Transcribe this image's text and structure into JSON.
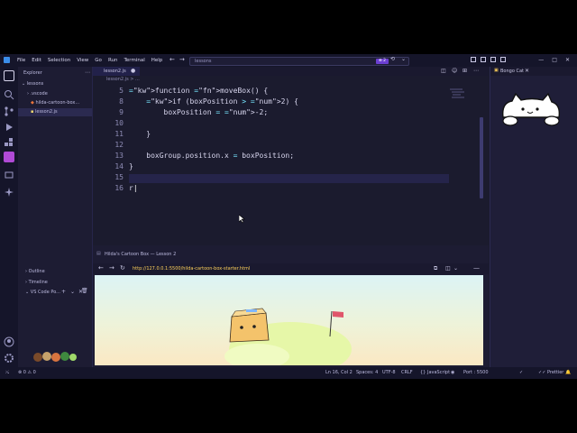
{
  "menu": [
    "File",
    "Edit",
    "Selection",
    "View",
    "Go",
    "Run",
    "Terminal",
    "Help"
  ],
  "command_center": {
    "text": "lessons",
    "badge": "⊕ 2"
  },
  "explorer": {
    "title": "Explorer",
    "root": "lessons",
    "items": [
      ".vscode",
      "hilda-cartoon-box...",
      "lesson2.js"
    ],
    "sections": [
      "Outline",
      "Timeline",
      "VS Code Po..."
    ]
  },
  "tab": {
    "label": "lesson2.js"
  },
  "breadcrumb": "lesson2.js > ...",
  "code": {
    "lines": [
      {
        "n": "5",
        "t": "function moveBox() {"
      },
      {
        "n": "8",
        "t": "    if (boxPosition > 2) {"
      },
      {
        "n": "9",
        "t": "        boxPosition = -2;"
      },
      {
        "n": "10",
        "t": ""
      },
      {
        "n": "11",
        "t": "    }"
      },
      {
        "n": "12",
        "t": ""
      },
      {
        "n": "13",
        "t": "    boxGroup.position.x = boxPosition;"
      },
      {
        "n": "14",
        "t": "}"
      },
      {
        "n": "15",
        "t": ""
      },
      {
        "n": "16",
        "t": "r"
      }
    ]
  },
  "right_panel": {
    "tab": "Bongo Cat"
  },
  "preview": {
    "title": "Hilda's Cartoon Box — Lesson 2",
    "url": "http://127.0.0.1:5500/hilda-cartoon-box-starter.html"
  },
  "status": {
    "left": "⊗ 0 ⚠ 0",
    "position": "Ln 16, Col 2",
    "spaces": "Spaces: 4",
    "encoding": "UTF-8",
    "eol": "CRLF",
    "language": "JavaScript",
    "port": "Port : 5500",
    "prettier": "Prettier"
  },
  "colors": {
    "accent": "#6b3fd1",
    "background": "#1b1b2e",
    "keyword": "#c86bff",
    "function": "#f0d970"
  }
}
